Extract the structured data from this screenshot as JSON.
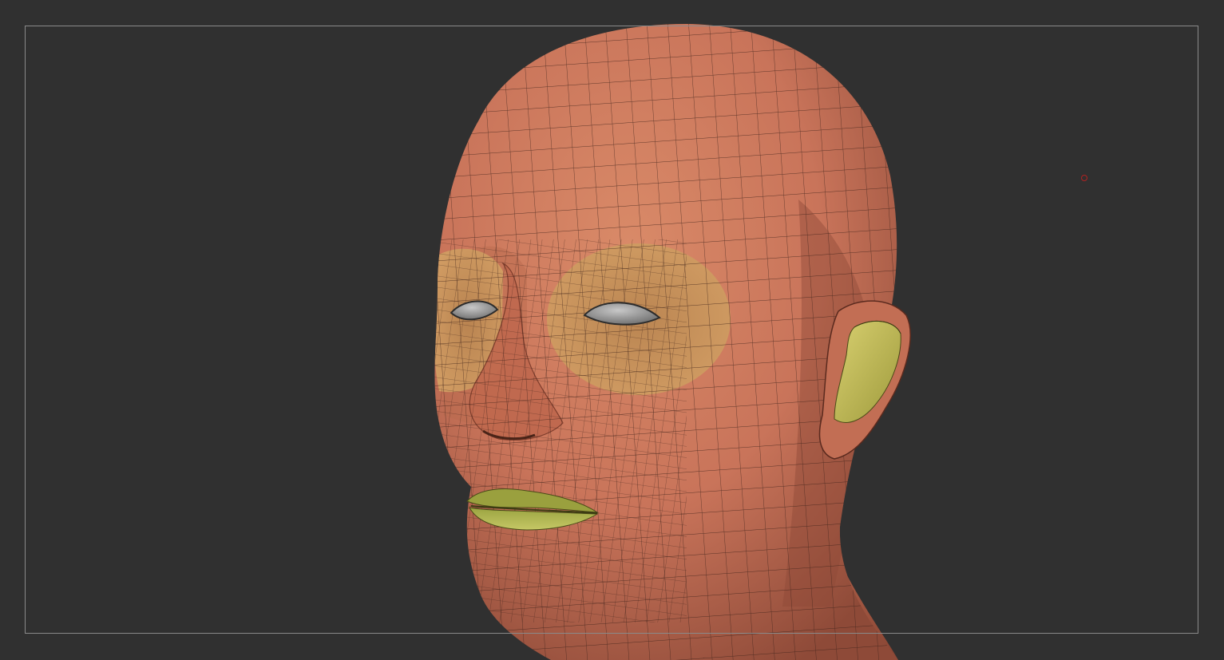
{
  "viewport": {
    "mode": "3d-sculpt-view",
    "subject": "head-mesh",
    "display": "polyframe-wireframe-on-shaded",
    "polygroups": [
      "skin",
      "eye-sockets",
      "ears",
      "lips",
      "eyeballs"
    ]
  },
  "colors": {
    "background": "#303030",
    "frame": "#8a8a8a",
    "skin": "#c9745a",
    "skin_dark": "#8e4a38",
    "skin_light": "#d98a68",
    "eye_socket": "#c99a5c",
    "ear_inner": "#c8c060",
    "lips": "#a8b048",
    "eyeball": "#9a9a9a",
    "wire": "#3a2018",
    "pivot": "#b02222"
  }
}
